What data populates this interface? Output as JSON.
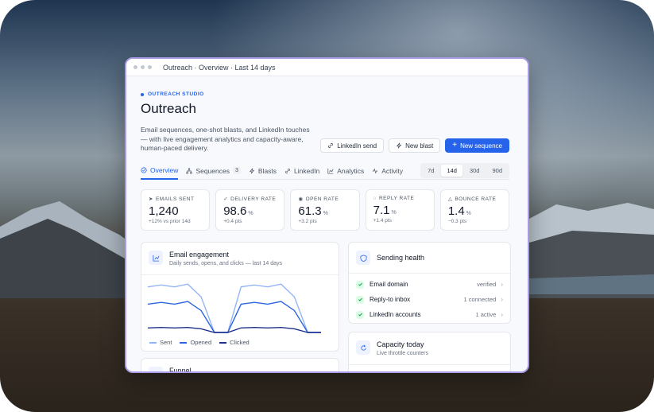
{
  "window": {
    "title": "Outreach · Overview · Last 14 days"
  },
  "header": {
    "eyebrow": "OUTREACH STUDIO",
    "title": "Outreach",
    "description": "Email sequences, one-shot blasts, and LinkedIn touches — with live engagement analytics and capacity-aware, human-paced delivery."
  },
  "actions": {
    "linkedin_send": "LinkedIn send",
    "new_blast": "New blast",
    "new_sequence": "New sequence"
  },
  "tabs": [
    {
      "label": "Overview",
      "icon": "check-circle-icon",
      "active": true
    },
    {
      "label": "Sequences",
      "icon": "sitemap-icon",
      "count": "3"
    },
    {
      "label": "Blasts",
      "icon": "bolt-icon"
    },
    {
      "label": "LinkedIn",
      "icon": "link-icon"
    },
    {
      "label": "Analytics",
      "icon": "chart-icon"
    },
    {
      "label": "Activity",
      "icon": "pulse-icon"
    }
  ],
  "range": {
    "options": [
      "7d",
      "14d",
      "30d",
      "90d"
    ],
    "selected": "14d"
  },
  "kpis": [
    {
      "label": "EMAILS SENT",
      "icon": "send-icon",
      "value": "1,240",
      "unit": "",
      "sub": "+12% vs prior 14d"
    },
    {
      "label": "DELIVERY RATE",
      "icon": "check-icon",
      "value": "98.6",
      "unit": "%",
      "sub": "+0.4 pts"
    },
    {
      "label": "OPEN RATE",
      "icon": "eye-icon",
      "value": "61.3",
      "unit": "%",
      "sub": "+3.2 pts"
    },
    {
      "label": "REPLY RATE",
      "icon": "chat-icon",
      "value": "7.1",
      "unit": "%",
      "sub": "+1.4 pts"
    },
    {
      "label": "BOUNCE RATE",
      "icon": "warning-icon",
      "value": "1.4",
      "unit": "%",
      "sub": "−0.3 pts"
    }
  ],
  "engagement": {
    "title": "Email engagement",
    "subtitle": "Daily sends, opens, and clicks — last 14 days"
  },
  "chart_data": {
    "type": "line",
    "x": [
      1,
      2,
      3,
      4,
      5,
      6,
      7,
      8,
      9,
      10,
      11,
      12,
      13,
      14
    ],
    "series": [
      {
        "name": "Sent",
        "color": "#93b4f5",
        "values": [
          100,
          104,
          100,
          106,
          78,
          0,
          0,
          100,
          104,
          100,
          106,
          78,
          0,
          0
        ]
      },
      {
        "name": "Opened",
        "color": "#2f66e0",
        "values": [
          62,
          66,
          62,
          68,
          48,
          0,
          0,
          62,
          66,
          62,
          68,
          48,
          0,
          0
        ]
      },
      {
        "name": "Clicked",
        "color": "#1e2f8a",
        "values": [
          10,
          11,
          10,
          11,
          8,
          0,
          0,
          10,
          11,
          10,
          11,
          8,
          0,
          0
        ]
      }
    ]
  },
  "funnel": {
    "title": "Funnel"
  },
  "health": {
    "title": "Sending health",
    "rows": [
      {
        "label": "Email domain",
        "status": "verified"
      },
      {
        "label": "Reply-to inbox",
        "status": "1 connected"
      },
      {
        "label": "LinkedIn accounts",
        "status": "1 active"
      }
    ]
  },
  "capacity": {
    "title": "Capacity today",
    "subtitle": "Live throttle counters"
  }
}
